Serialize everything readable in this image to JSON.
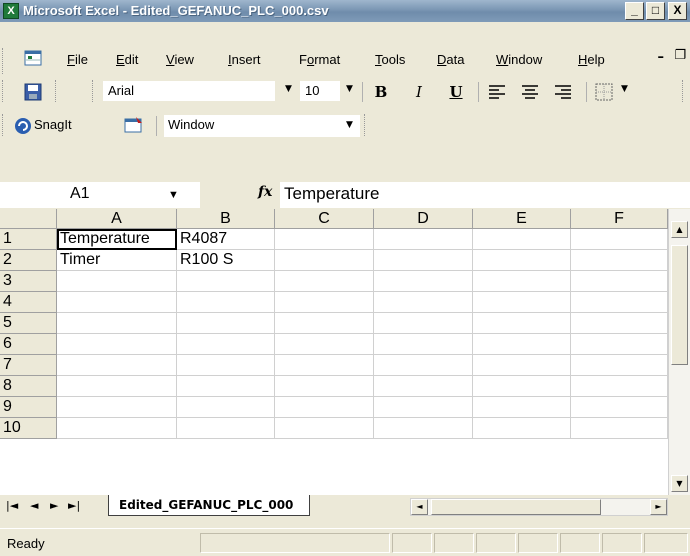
{
  "window": {
    "title": "Microsoft Excel - Edited_GEFANUC_PLC_000.csv",
    "app_icon_glyph": "X",
    "minimize_glyph": "_",
    "maximize_glyph": "□",
    "close_glyph": "X"
  },
  "menu": {
    "items": [
      {
        "label": "File",
        "ul": "F",
        "rest": "ile"
      },
      {
        "label": "Edit",
        "ul": "E",
        "rest": "dit"
      },
      {
        "label": "View",
        "ul": "V",
        "rest": "iew"
      },
      {
        "label": "Insert",
        "ul": "I",
        "rest": "nsert"
      },
      {
        "label": "Format",
        "pre": "F",
        "ul": "o",
        "rest": "rmat"
      },
      {
        "label": "Tools",
        "ul": "T",
        "rest": "ools"
      },
      {
        "label": "Data",
        "ul": "D",
        "rest": "ata"
      },
      {
        "label": "Window",
        "ul": "W",
        "rest": "indow"
      },
      {
        "label": "Help",
        "ul": "H",
        "rest": "elp"
      }
    ],
    "doc_minimize": "–",
    "doc_restore": "❐",
    "doc_close": "×"
  },
  "toolbar": {
    "font_name": "Arial",
    "font_size": "10",
    "bold": "B",
    "italic": "I",
    "underline": "U"
  },
  "snagit": {
    "label": "SnagIt",
    "capture_target": "Window"
  },
  "formula_bar": {
    "name_box": "A1",
    "fx": "fx",
    "content": "Temperature"
  },
  "sheet": {
    "columns": [
      "A",
      "B",
      "C",
      "D",
      "E",
      "F"
    ],
    "rows": [
      {
        "num": "1",
        "A": "Temperature",
        "B": "R4087"
      },
      {
        "num": "2",
        "A": "Timer",
        "B": "R100 S"
      },
      {
        "num": "3"
      },
      {
        "num": "4"
      },
      {
        "num": "5"
      },
      {
        "num": "6"
      },
      {
        "num": "7"
      },
      {
        "num": "8"
      },
      {
        "num": "9"
      },
      {
        "num": "10"
      }
    ],
    "selected_cell": "A1"
  },
  "tabs": {
    "nav": [
      "|◄",
      "◄",
      "►",
      "►|"
    ],
    "active_sheet": "Edited_GEFANUC_PLC_000"
  },
  "status": {
    "text": "Ready"
  },
  "colors": {
    "titlebar": "#7a96b3",
    "chrome": "#ece9d8",
    "grid_line": "#d0d0d0"
  }
}
